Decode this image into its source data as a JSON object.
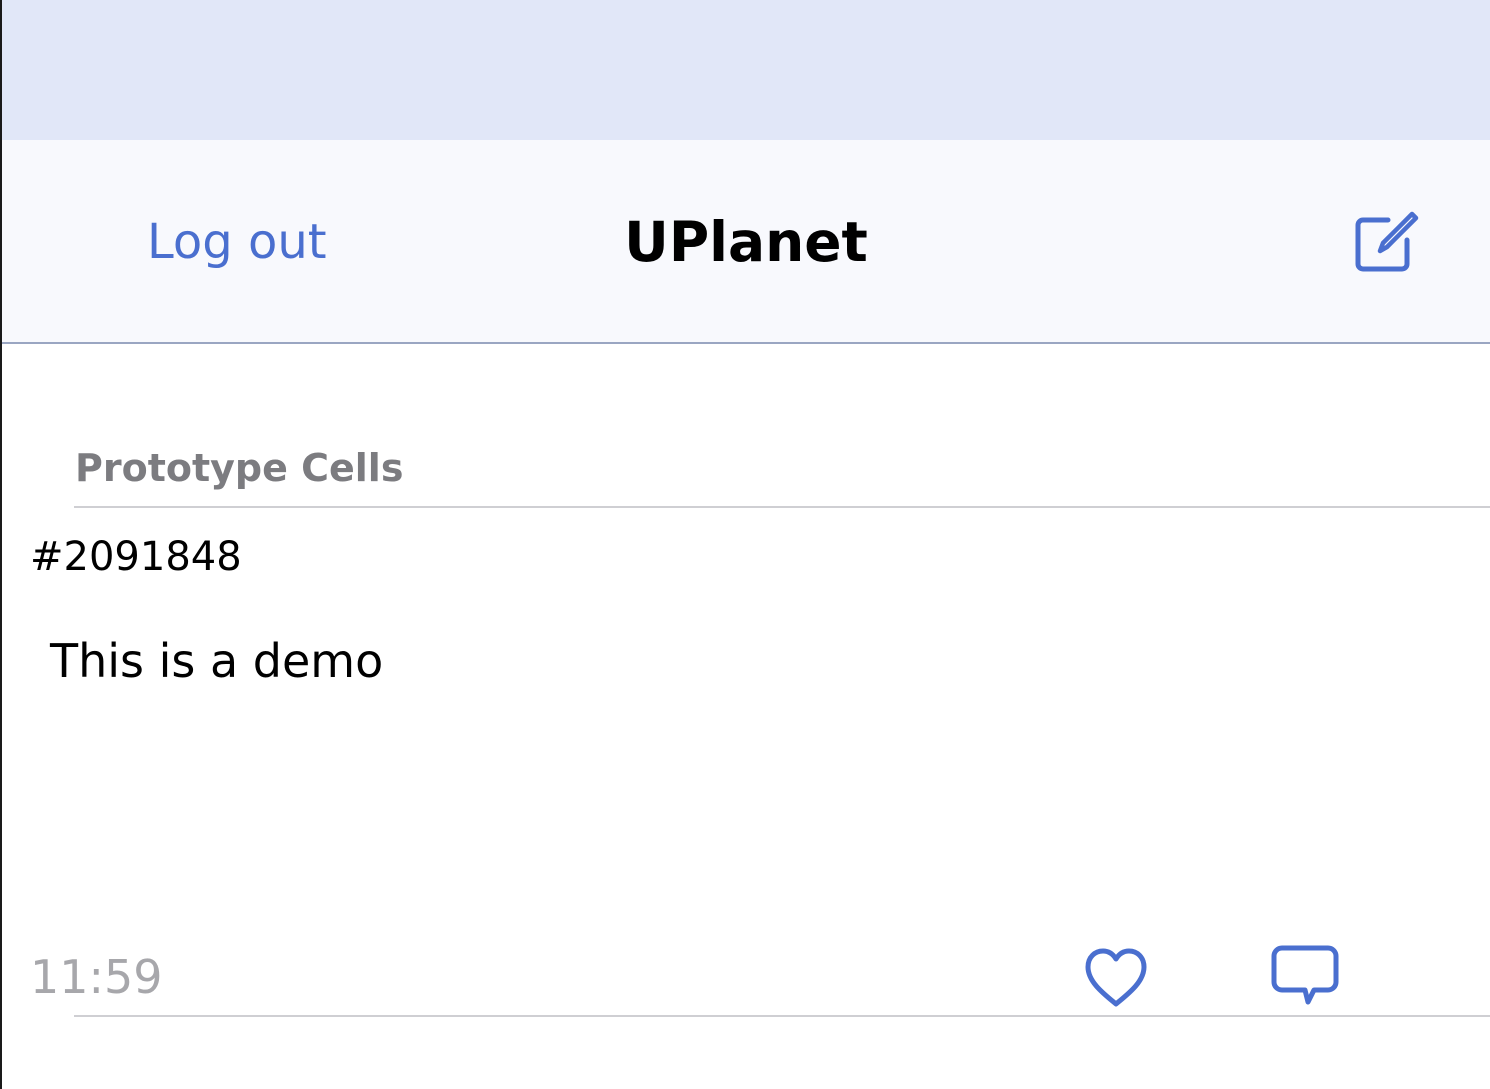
{
  "nav": {
    "left_label": "Log out",
    "title": "UPlanet",
    "right_icon": "compose-icon"
  },
  "table": {
    "section_header": "Prototype Cells",
    "cell": {
      "id": "#2091848",
      "body": "This is a demo",
      "time": "11:59",
      "like_icon": "heart-icon",
      "comment_icon": "comment-bubble-icon"
    }
  },
  "colors": {
    "tint": "#4a6fcf",
    "status_bar": "#e1e7f8",
    "nav_bar": "#f8f9fd",
    "secondary_text": "#7c7c80",
    "time_text": "#a7a7ab"
  }
}
